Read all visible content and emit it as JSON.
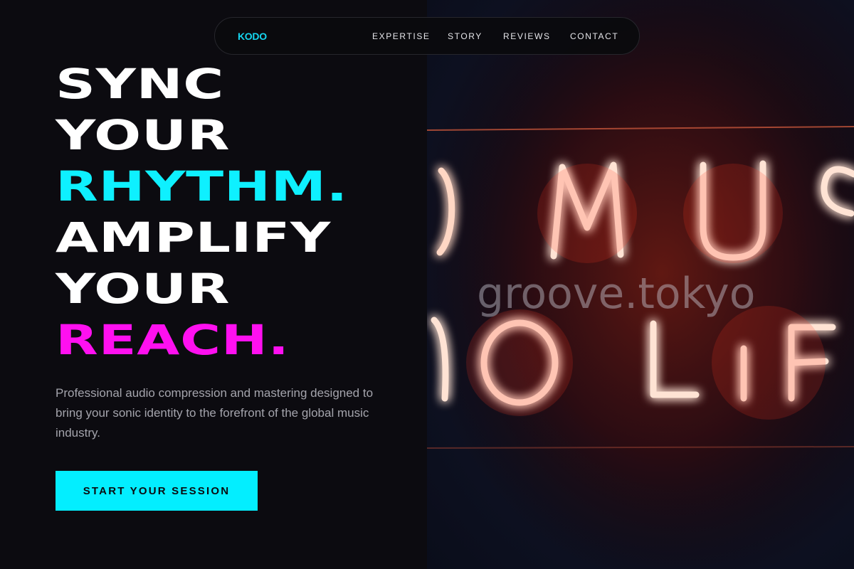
{
  "nav": {
    "logo": "KODO",
    "links": [
      "EXPERTISE",
      "STORY",
      "REVIEWS",
      "CONTACT"
    ]
  },
  "hero": {
    "headline": [
      "SYNC",
      "YOUR",
      "RHYTHM.",
      "AMPLIFY",
      "YOUR",
      "REACH."
    ],
    "description": "Professional audio compression and mastering designed to bring your sonic identity to the forefront of the global music industry.",
    "cta_label": "START YOUR SESSION"
  },
  "image": {
    "sign_top": "MUS",
    "sign_bottom": "O LIF",
    "watermark": "groove.tokyo"
  },
  "colors": {
    "accent_cyan": "#0ef0ff",
    "accent_magenta": "#ff10f0",
    "background": "#0c0b10",
    "neon": "#ff5a3c"
  }
}
